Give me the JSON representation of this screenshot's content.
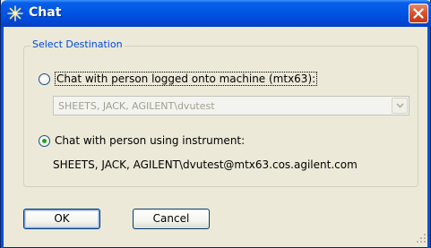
{
  "window": {
    "title": "Chat"
  },
  "group": {
    "legend": "Select Destination"
  },
  "options": {
    "machine_label": "Chat with person logged onto machine (mtx63):",
    "machine_selected": false,
    "machine_combo_value": "SHEETS, JACK, AGILENT\\dvutest",
    "instrument_label": "Chat with person using instrument:",
    "instrument_selected": true,
    "instrument_address": "SHEETS, JACK, AGILENT\\dvutest@mtx63.cos.agilent.com"
  },
  "buttons": {
    "ok": "OK",
    "cancel": "Cancel"
  },
  "colors": {
    "titlebar": "#0055e5",
    "close": "#d9542c",
    "legend": "#0046d5",
    "radio_dot": "#21a121",
    "dialog_bg": "#ece9d8"
  },
  "icons": {
    "title": "sparkle-icon",
    "close": "close-icon",
    "combo": "chevron-down-icon",
    "grip": "resize-grip-icon"
  }
}
